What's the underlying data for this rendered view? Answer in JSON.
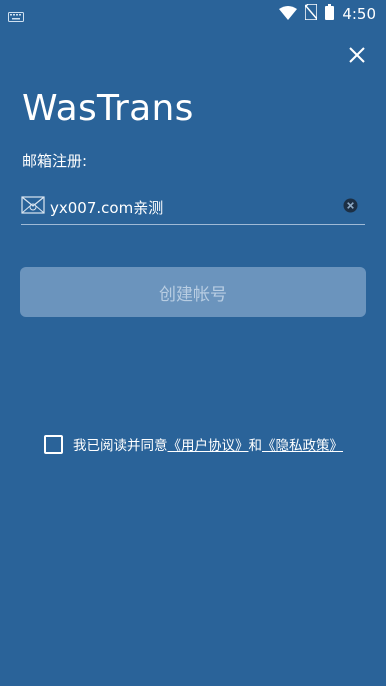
{
  "status_bar": {
    "time": "4:50",
    "icons": [
      "keyboard-icon",
      "wifi-icon",
      "no-sim-icon",
      "battery-icon"
    ]
  },
  "header": {
    "close_icon": "close-icon",
    "app_title": "WasTrans"
  },
  "form": {
    "subtitle": "邮箱注册:",
    "email_value": "yx007.com亲测",
    "email_icon": "mail-icon",
    "clear_icon": "clear-circle-icon",
    "create_button_label": "创建帐号"
  },
  "agreement": {
    "prefix": "我已阅读并同意",
    "user_agreement": "《用户协议》",
    "connector": "和",
    "privacy_policy": "《隐私政策》",
    "checked": false
  },
  "colors": {
    "background": "#2a6399",
    "button_disabled": "#6b94bd",
    "button_text": "#b8cde2"
  }
}
